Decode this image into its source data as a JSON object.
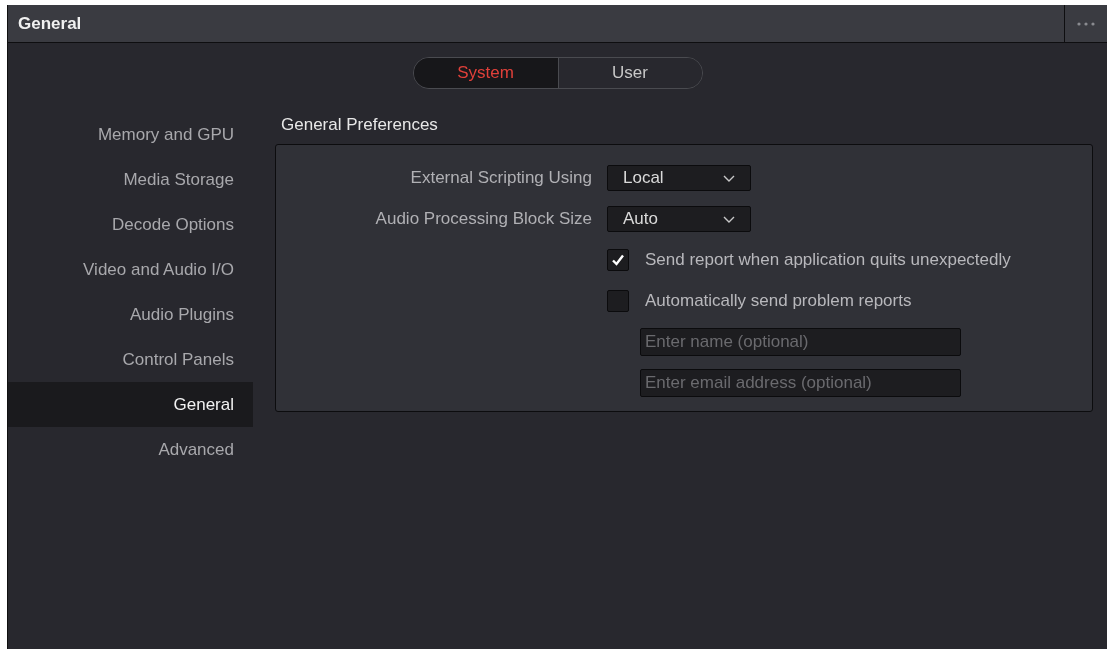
{
  "window": {
    "title": "General"
  },
  "tabs": [
    {
      "label": "System",
      "selected": true
    },
    {
      "label": "User",
      "selected": false
    }
  ],
  "sidebar": {
    "items": [
      {
        "label": "Memory and GPU",
        "selected": false
      },
      {
        "label": "Media Storage",
        "selected": false
      },
      {
        "label": "Decode Options",
        "selected": false
      },
      {
        "label": "Video and Audio I/O",
        "selected": false
      },
      {
        "label": "Audio Plugins",
        "selected": false
      },
      {
        "label": "Control Panels",
        "selected": false
      },
      {
        "label": "General",
        "selected": true
      },
      {
        "label": "Advanced",
        "selected": false
      }
    ]
  },
  "section": {
    "title": "General Preferences"
  },
  "settings": [
    {
      "kind": "dropdown",
      "label": "External Scripting Using",
      "value": "Local"
    },
    {
      "kind": "dropdown",
      "label": "Audio Processing Block Size",
      "value": "Auto"
    },
    {
      "kind": "checkbox",
      "label": "Send report when application quits unexpectedly",
      "checked": true
    },
    {
      "kind": "checkbox",
      "label": "Automatically send problem reports",
      "checked": false
    },
    {
      "kind": "textfield",
      "placeholder": "Enter name (optional)"
    },
    {
      "kind": "textfield",
      "placeholder": "Enter email address (optional)"
    }
  ]
}
